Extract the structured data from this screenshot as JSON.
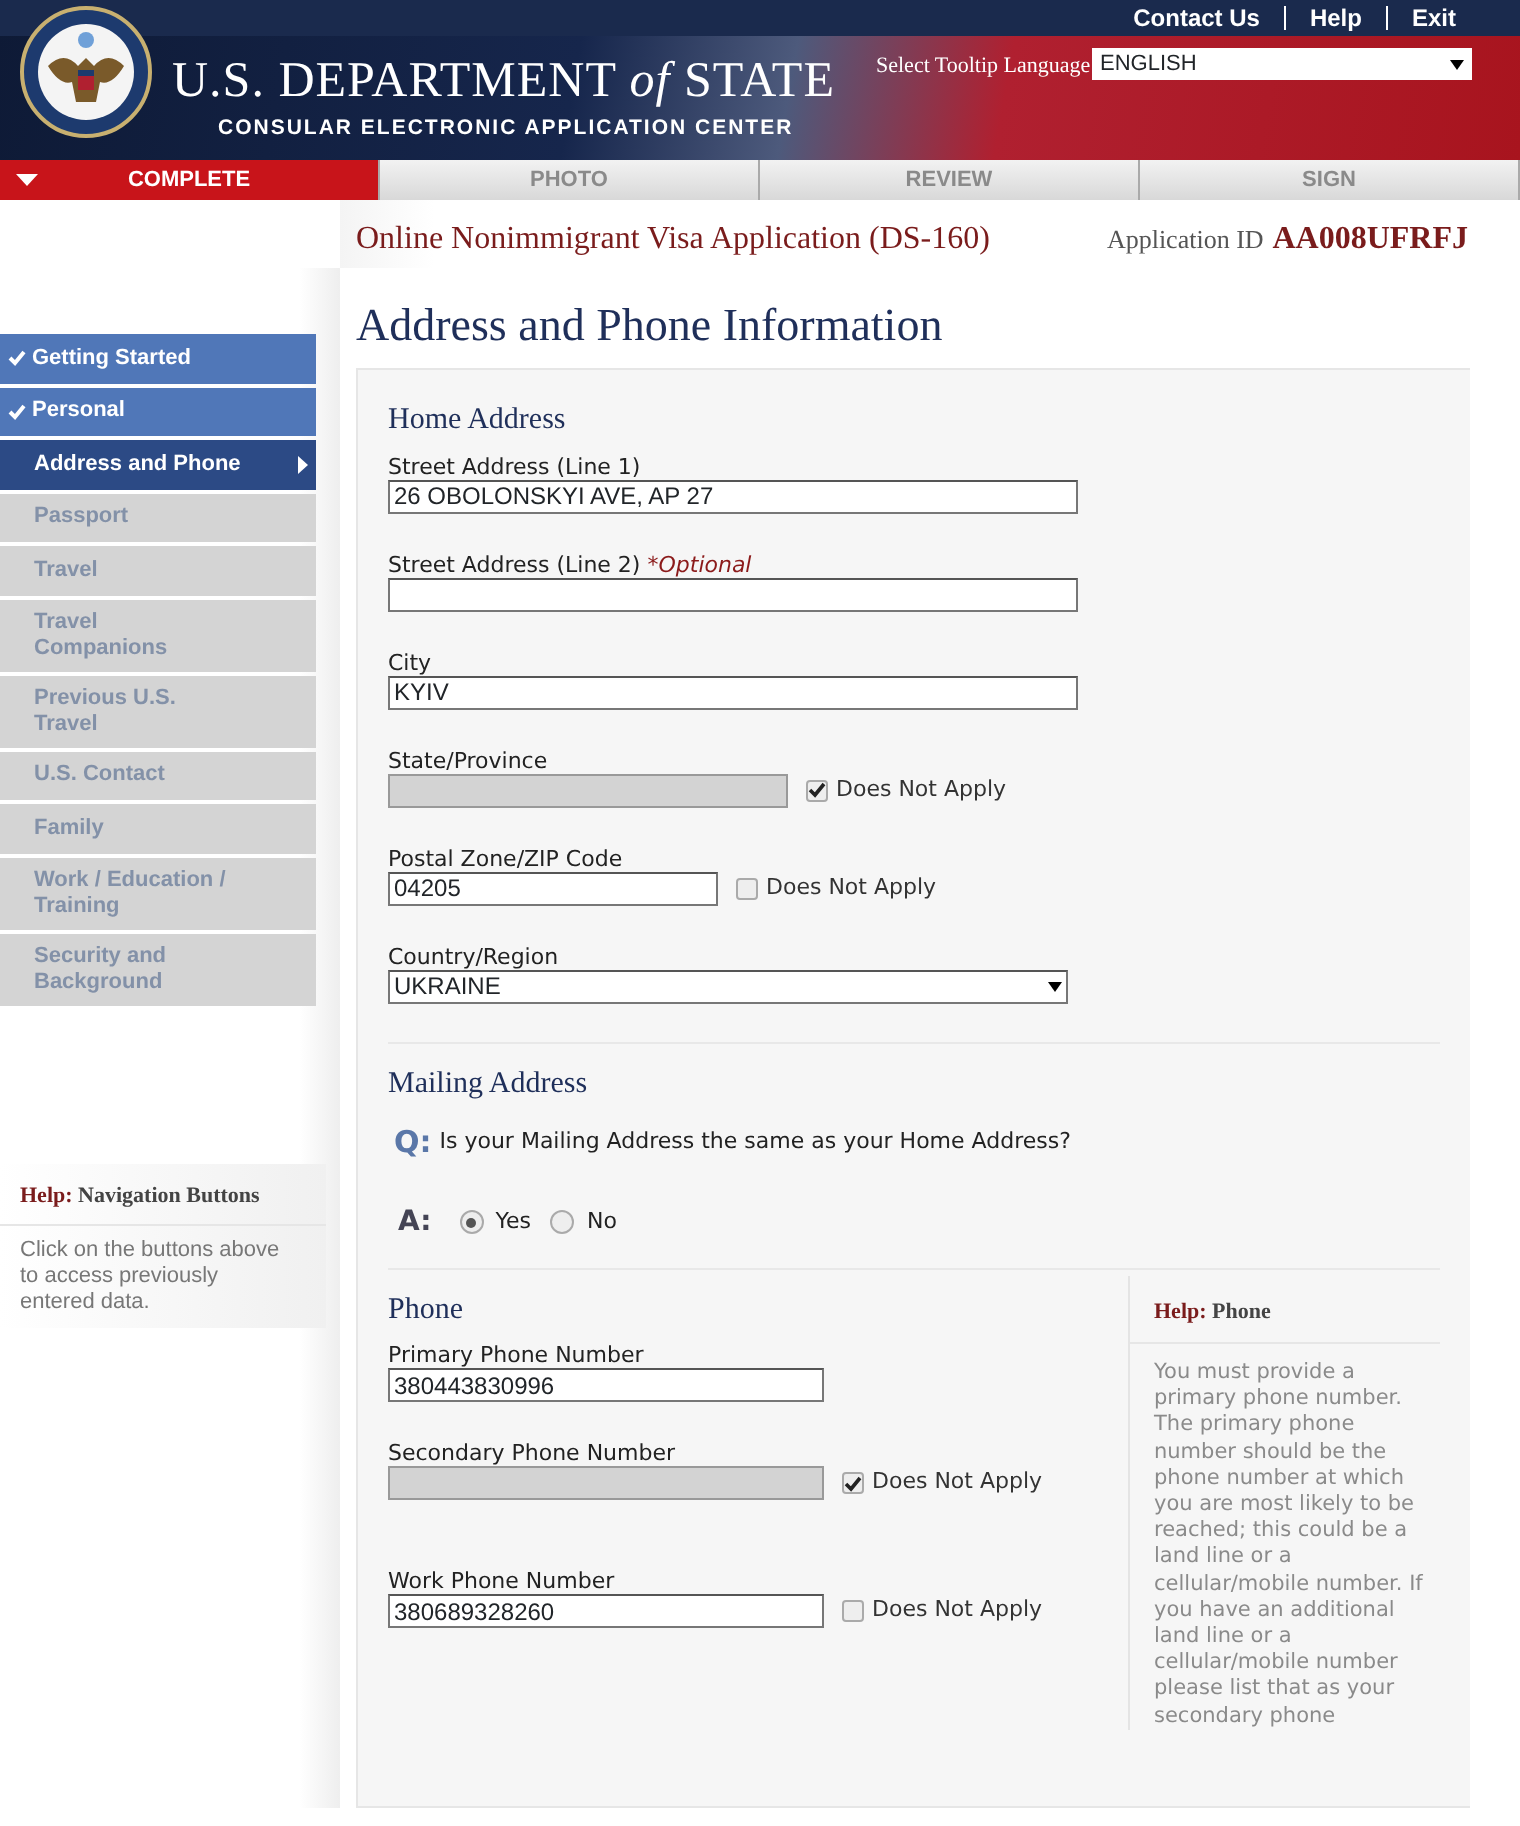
{
  "header": {
    "links": [
      "Contact Us",
      "Help",
      "Exit"
    ],
    "agency": "U.S. DEPARTMENT *of* STATE",
    "subtitle": "CONSULAR ELECTRONIC APPLICATION CENTER",
    "tooltip_label": "Select Tooltip Language",
    "tooltip_language": "ENGLISH"
  },
  "steps": [
    {
      "label": "COMPLETE",
      "selected": true
    },
    {
      "label": "PHOTO",
      "selected": false
    },
    {
      "label": "REVIEW",
      "selected": false
    },
    {
      "label": "SIGN",
      "selected": false
    }
  ],
  "form_title": "Online Nonimmigrant Visa Application (DS-160)",
  "application_id_label": "Application ID",
  "application_id": "AA008UFRFJ",
  "sidebar": {
    "items": [
      {
        "label": "Getting Started",
        "completed": true,
        "selected": false
      },
      {
        "label": "Personal",
        "completed": true,
        "selected": false
      },
      {
        "label": "Address and Phone",
        "completed": false,
        "selected": true
      },
      {
        "label": "Passport",
        "completed": false,
        "selected": false
      },
      {
        "label": "Travel",
        "completed": false,
        "selected": false
      },
      {
        "label": "Travel Companions",
        "completed": false,
        "selected": false
      },
      {
        "label": "Previous U.S. Travel",
        "completed": false,
        "selected": false
      },
      {
        "label": "U.S. Contact",
        "completed": false,
        "selected": false
      },
      {
        "label": "Family",
        "completed": false,
        "selected": false
      },
      {
        "label": "Work / Education / Training",
        "completed": false,
        "selected": false
      },
      {
        "label": "Security and Background",
        "completed": false,
        "selected": false
      }
    ]
  },
  "nav_help": {
    "title_label": "Help:",
    "title": "Navigation Buttons",
    "text": "Click on the buttons above to access previously entered data."
  },
  "page_title": "Address and Phone Information",
  "home_address": {
    "heading": "Home Address",
    "fields": [
      {
        "kind": "wide",
        "label": "Street Address (Line 1)",
        "value": "26 OBOLONSKYI AVE, AP 27"
      },
      {
        "kind": "wide",
        "label": "Street Address (Line 2)",
        "note": "*Optional"
      },
      {
        "kind": "wide",
        "label": "City",
        "value": "KYIV"
      },
      {
        "kind": "medium",
        "label": "State/Province",
        "does_not_apply": {
          "label": "Does Not Apply",
          "checked": true
        }
      },
      {
        "kind": "short",
        "label": "Postal Zone/ZIP Code",
        "value": "04205",
        "does_not_apply": {
          "label": "Does Not Apply",
          "checked": false
        }
      },
      {
        "kind": "select",
        "label": "Country/Region",
        "value": "UKRAINE"
      }
    ]
  },
  "mailing_address": {
    "heading": "Mailing Address",
    "q_mark": "Q:",
    "question": "Is your Mailing Address the same as your Home Address?",
    "a_mark": "A:",
    "options": [
      {
        "label": "Yes",
        "selected": true
      },
      {
        "label": "No",
        "selected": false
      }
    ]
  },
  "phone": {
    "heading": "Phone",
    "fields": [
      {
        "kind": "phone",
        "label": "Primary Phone Number",
        "value": "380443830996"
      },
      {
        "kind": "phone",
        "label": "Secondary Phone Number",
        "does_not_apply": {
          "label": "Does Not Apply",
          "checked": true
        }
      },
      {
        "kind": "phone",
        "label": "Work Phone Number",
        "value": "380689328260",
        "does_not_apply": {
          "label": "Does Not Apply",
          "checked": false
        }
      }
    ],
    "help": {
      "title_label": "Help:",
      "title": "Phone",
      "text": "You must provide a primary phone number. The primary phone number should be the phone number at which you are most likely to be reached; this could be a land line or a cellular/mobile number. If you have an additional land line or a cellular/mobile number please list that as your secondary phone"
    }
  }
}
